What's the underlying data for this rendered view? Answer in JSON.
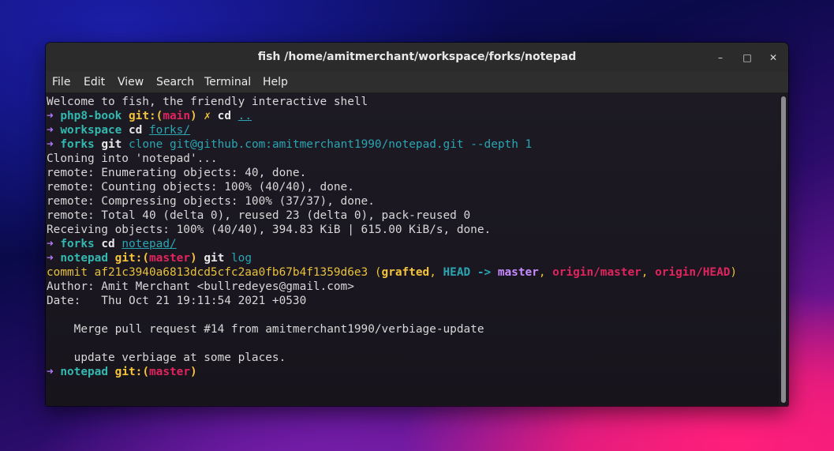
{
  "window": {
    "title": "fish  /home/amitmerchant/workspace/forks/notepad",
    "minimize_glyph": "–",
    "maximize_glyph": "□",
    "close_glyph": "✕"
  },
  "menu": [
    "File",
    "Edit",
    "View",
    "Search",
    "Terminal",
    "Help"
  ],
  "colors": {
    "arrow": "#b27cff",
    "directory": "#33b8b0",
    "git_label": "#f5c33b",
    "branch": "#e0245e",
    "argument": "#2aa6b3"
  },
  "terminal": {
    "welcome": "Welcome to fish, the friendly interactive shell",
    "prompt_symbol": "➜",
    "git_prefix": "git:(",
    "git_suffix": ")",
    "dirty_mark": "✗",
    "p1": {
      "dir": "php8-book",
      "branch": "main",
      "cmd": "cd",
      "arg": ".."
    },
    "p2": {
      "dir": "workspace",
      "cmd": "cd",
      "arg": "forks/"
    },
    "p3": {
      "dir": "forks",
      "cmd": "git",
      "arg": "clone git@github.com:amitmerchant1990/notepad.git --depth 1"
    },
    "output1": [
      "Cloning into 'notepad'...",
      "remote: Enumerating objects: 40, done.",
      "remote: Counting objects: 100% (40/40), done.",
      "remote: Compressing objects: 100% (37/37), done.",
      "remote: Total 40 (delta 0), reused 23 (delta 0), pack-reused 0",
      "Receiving objects: 100% (40/40), 394.83 KiB | 615.00 KiB/s, done."
    ],
    "p4": {
      "dir": "forks",
      "cmd": "cd",
      "arg": "notepad/"
    },
    "p5": {
      "dir": "notepad",
      "branch": "master",
      "cmd": "git",
      "arg": "log"
    },
    "commit": {
      "prefix": "commit af21c3940a6813dcd5cfc2aa0fb67b4f1359d6e3 (",
      "grafted": "grafted",
      "sep1": ", ",
      "head": "HEAD -> ",
      "master": "master",
      "sep2": ", ",
      "origin_master": "origin/master",
      "sep3": ", ",
      "origin_head": "origin/HEAD",
      "close": ")"
    },
    "author": "Author: Amit Merchant <bullredeyes@gmail.com>",
    "date": "Date:   Thu Oct 21 19:11:54 2021 +0530",
    "message1": "    Merge pull request #14 from amitmerchant1990/verbiage-update",
    "message2": "    update verbiage at some places.",
    "p6": {
      "dir": "notepad",
      "branch": "master"
    }
  }
}
